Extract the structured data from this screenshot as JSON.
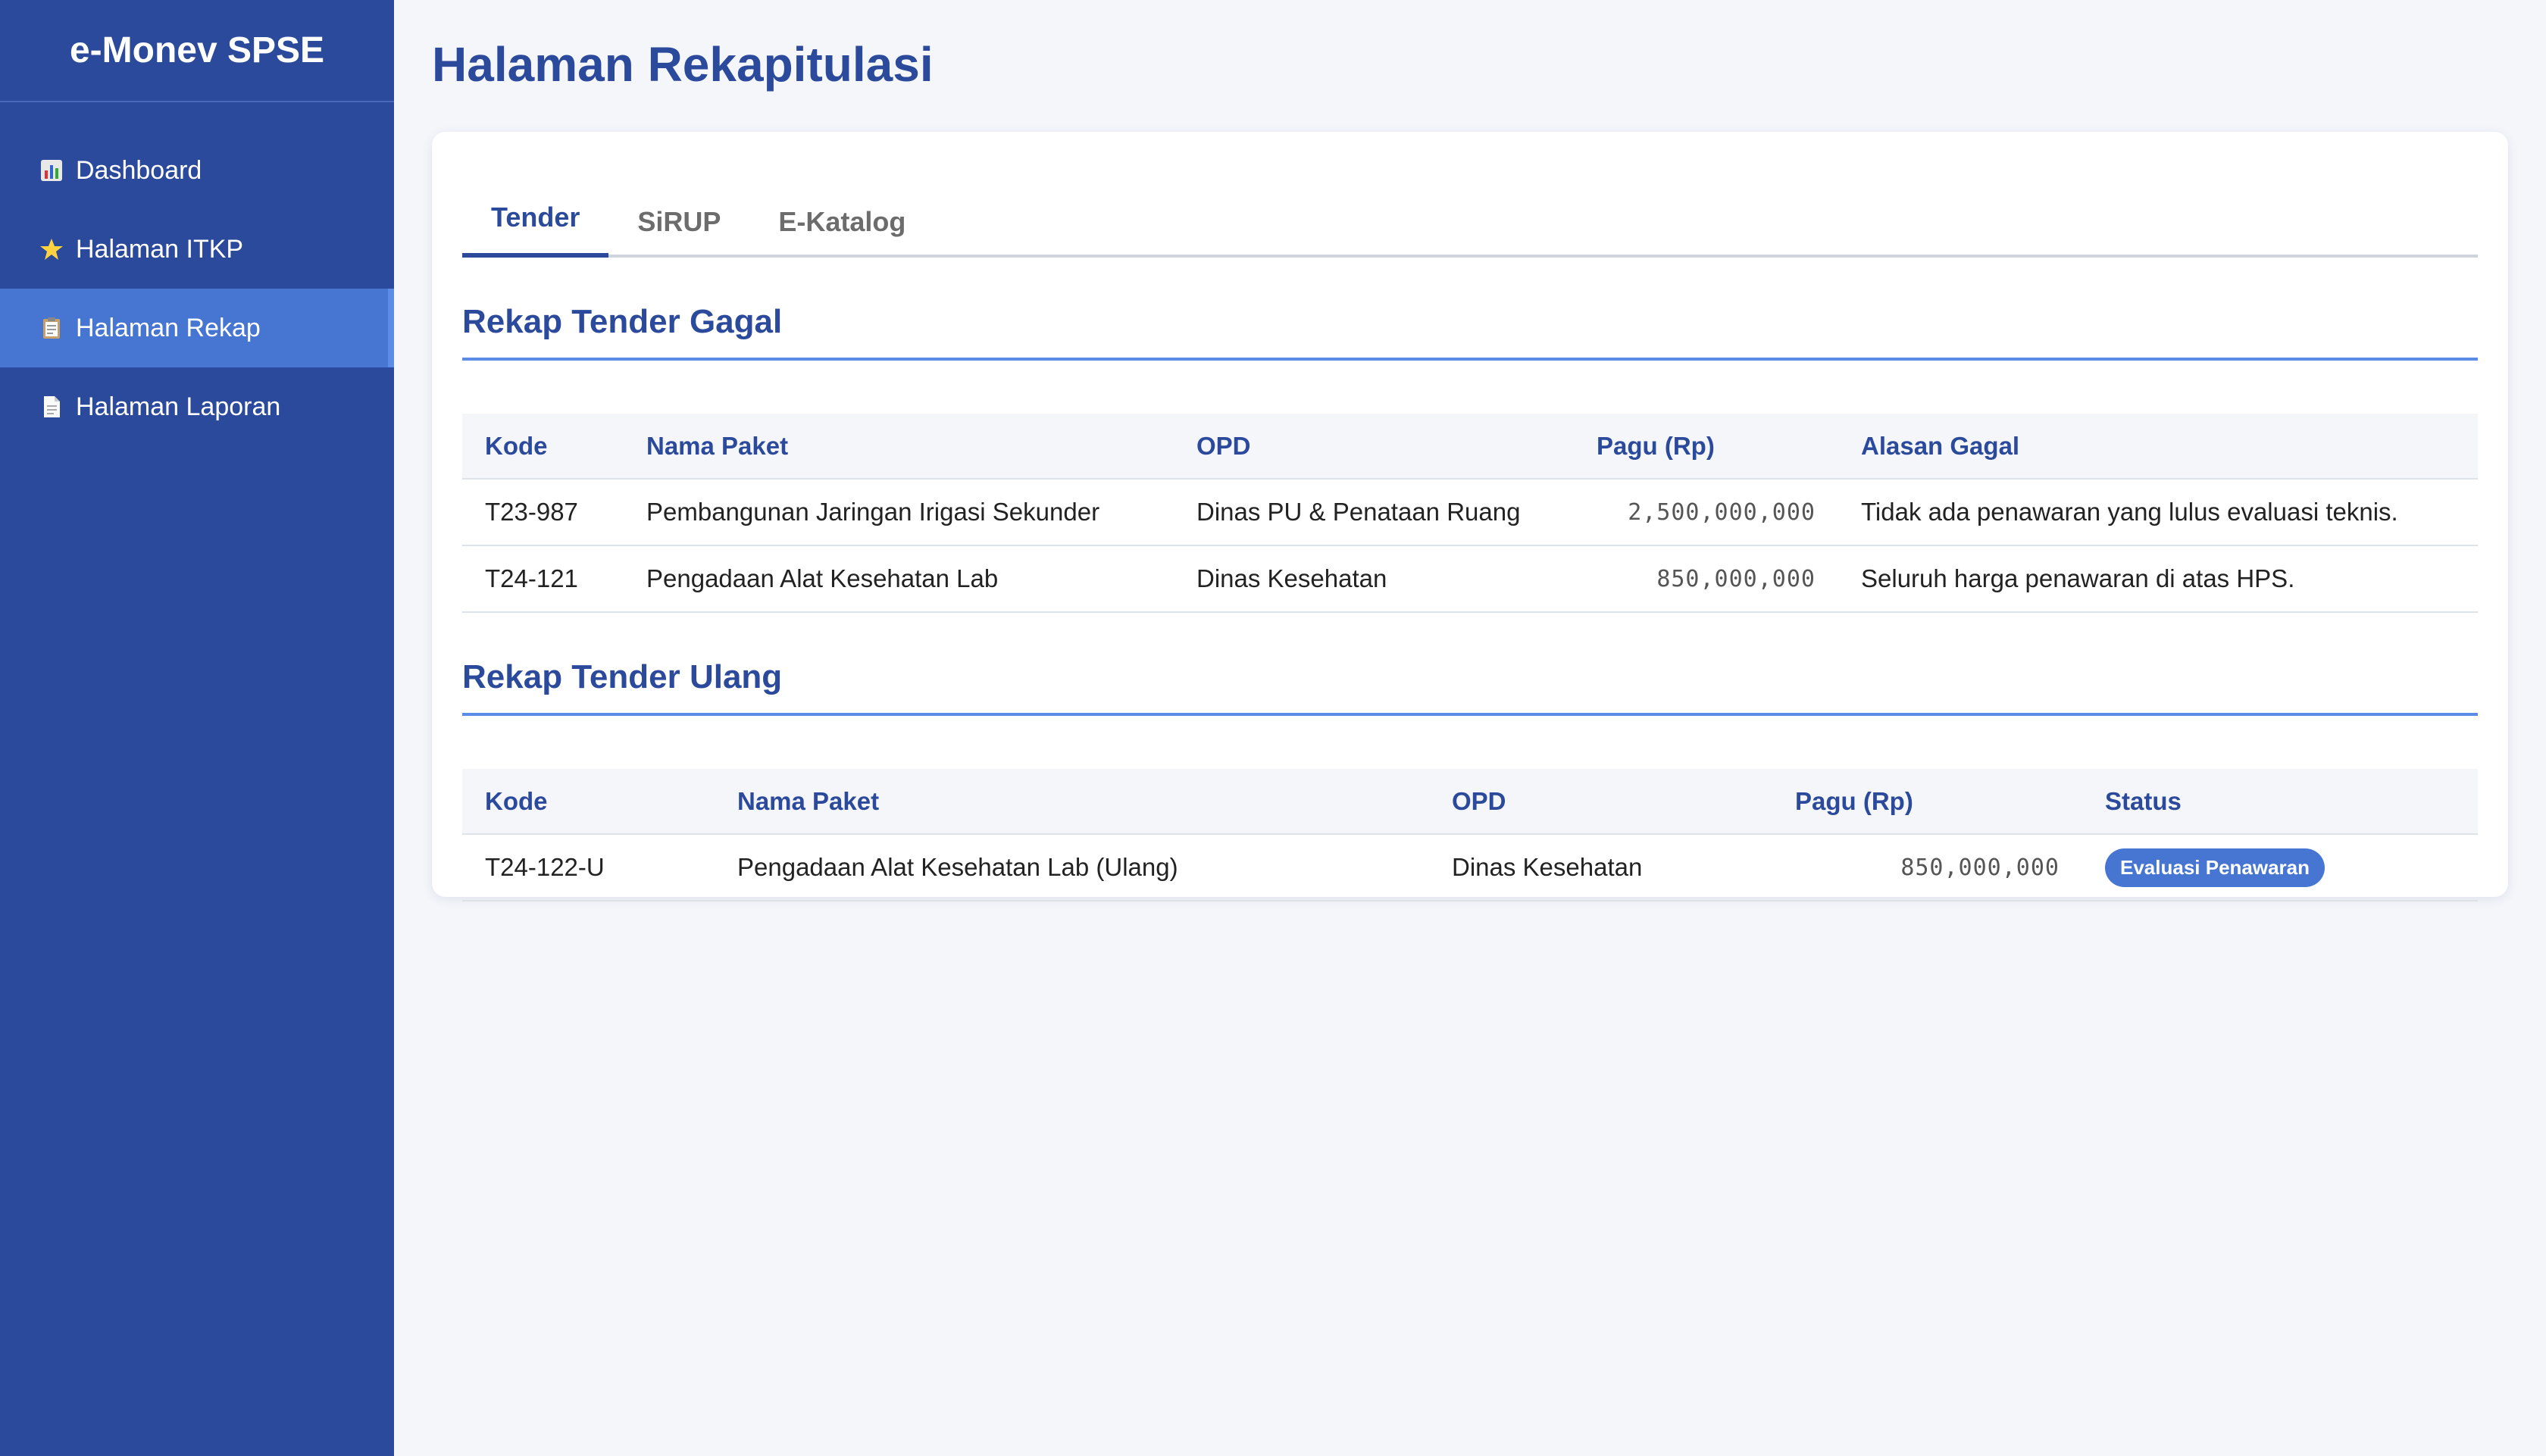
{
  "app": {
    "title": "e-Monev SPSE"
  },
  "sidebar": {
    "items": [
      {
        "label": "Dashboard",
        "icon": "bar-chart-icon"
      },
      {
        "label": "Halaman ITKP",
        "icon": "star-icon"
      },
      {
        "label": "Halaman Rekap",
        "icon": "clipboard-icon",
        "active": true
      },
      {
        "label": "Halaman Laporan",
        "icon": "document-icon"
      }
    ]
  },
  "page": {
    "title": "Halaman Rekapitulasi"
  },
  "tabs": [
    {
      "label": "Tender",
      "active": true
    },
    {
      "label": "SiRUP"
    },
    {
      "label": "E-Katalog"
    }
  ],
  "gagal": {
    "title": "Rekap Tender Gagal",
    "headers": [
      "Kode",
      "Nama Paket",
      "OPD",
      "Pagu (Rp)",
      "Alasan Gagal"
    ],
    "rows": [
      [
        "T23-987",
        "Pembangunan Jaringan Irigasi Sekunder",
        "Dinas PU & Penataan Ruang",
        "2,500,000,000",
        "Tidak ada penawaran yang lulus evaluasi teknis."
      ],
      [
        "T24-121",
        "Pengadaan Alat Kesehatan Lab",
        "Dinas Kesehatan",
        "850,000,000",
        "Seluruh harga penawaran di atas HPS."
      ]
    ]
  },
  "ulang": {
    "title": "Rekap Tender Ulang",
    "headers": [
      "Kode",
      "Nama Paket",
      "OPD",
      "Pagu (Rp)",
      "Status"
    ],
    "rows": [
      [
        "T24-122-U",
        "Pengadaan Alat Kesehatan Lab (Ulang)",
        "Dinas Kesehatan",
        "850,000,000",
        "Evaluasi Penawaran"
      ]
    ]
  },
  "colors": {
    "sidebar": "#2c4a9c",
    "accent": "#4675d2",
    "title": "#2c4a9c"
  }
}
